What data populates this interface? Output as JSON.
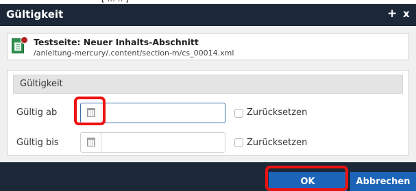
{
  "top_fragment": "[ ... .. ]",
  "window": {
    "title": "Gültigkeit",
    "plus_icon": "+",
    "close_icon": "x"
  },
  "resource": {
    "icon": "container-page-icon",
    "status_icon": "red-dot-icon",
    "title": "Testseite: Neuer Inhalts-Abschnitt",
    "path": "/anleitung-mercury/.content/section-m/cs_00014.xml"
  },
  "validity": {
    "legend": "Gültigkeit",
    "rows": [
      {
        "label": "Gültig ab",
        "value": "",
        "reset_label": "Zurücksetzen",
        "reset_checked": false,
        "focused": true
      },
      {
        "label": "Gültig bis",
        "value": "",
        "reset_label": "Zurücksetzen",
        "reset_checked": false,
        "focused": false
      }
    ]
  },
  "buttons": {
    "ok": "OK",
    "cancel": "Abbrechen"
  },
  "colors": {
    "titlebar": "#1c2838",
    "button": "#1c64b8",
    "highlight": "#ee1111"
  }
}
